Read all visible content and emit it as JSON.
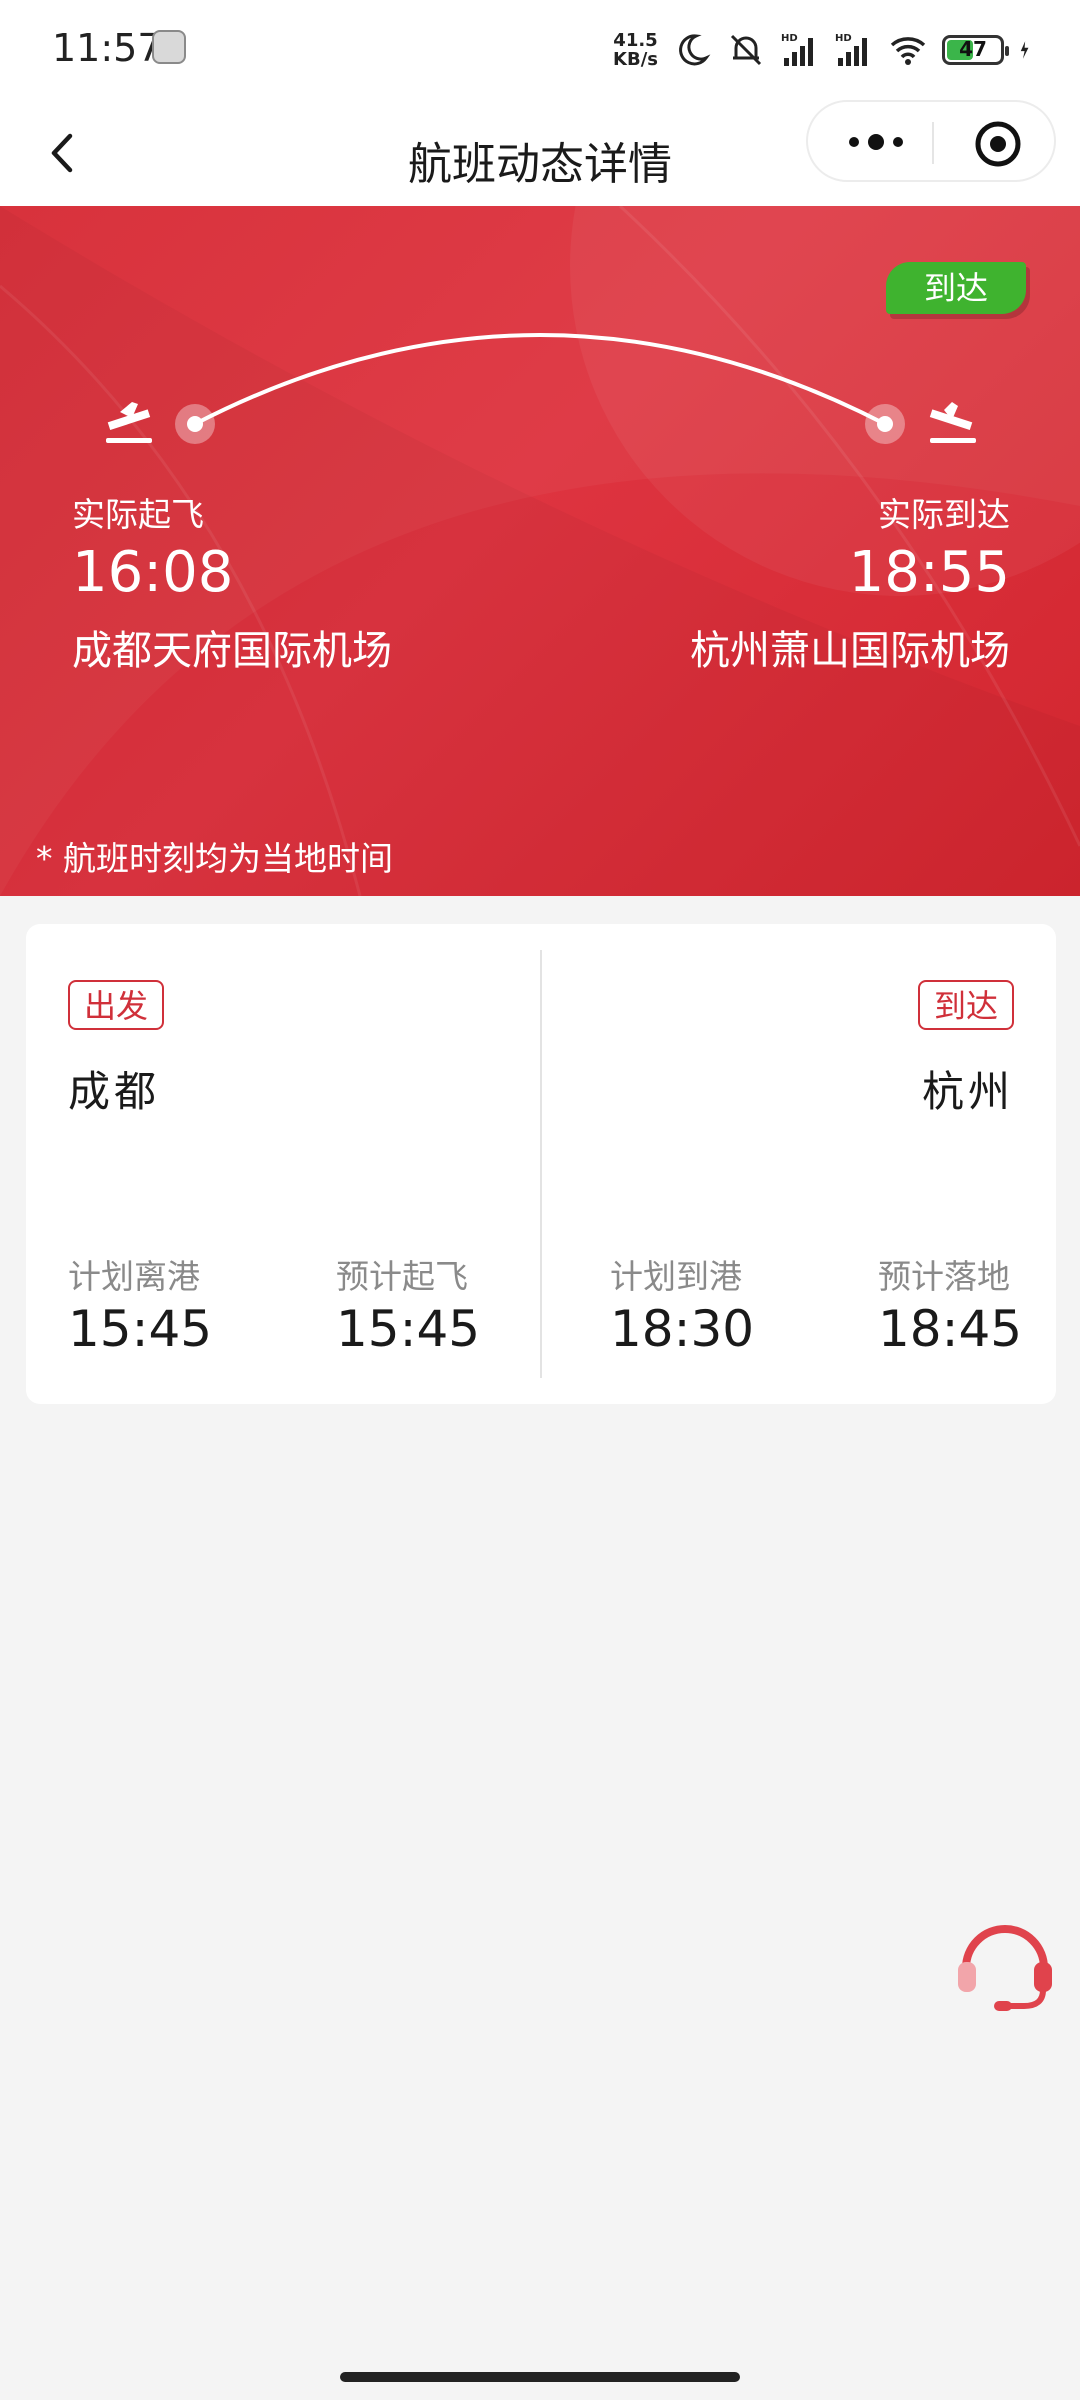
{
  "status_bar": {
    "time": "11:57",
    "net_speed_value": "41.5",
    "net_speed_unit": "KB/s",
    "battery": "47",
    "icons": [
      "moon-icon",
      "bell-muted-icon",
      "signal-hd-icon",
      "signal-hd-icon",
      "wifi-icon",
      "charging-icon"
    ]
  },
  "nav": {
    "title": "航班动态详情"
  },
  "hero": {
    "badge": "到达",
    "badge_color": "#3fb32f",
    "accent_color": "#d72a35",
    "departure": {
      "label": "实际起飞",
      "time": "16:08",
      "airport": "成都天府国际机场"
    },
    "arrival": {
      "label": "实际到达",
      "time": "18:55",
      "airport": "杭州萧山国际机场"
    },
    "note": "* 航班时刻均为当地时间"
  },
  "card": {
    "departure": {
      "tag": "出发",
      "city": "成都",
      "planned_label": "计划离港",
      "planned_time": "15:45",
      "estimated_label": "预计起飞",
      "estimated_time": "15:45"
    },
    "arrival": {
      "tag": "到达",
      "city": "杭州",
      "planned_label": "计划到港",
      "planned_time": "18:30",
      "estimated_label": "预计落地",
      "estimated_time": "18:45"
    }
  }
}
